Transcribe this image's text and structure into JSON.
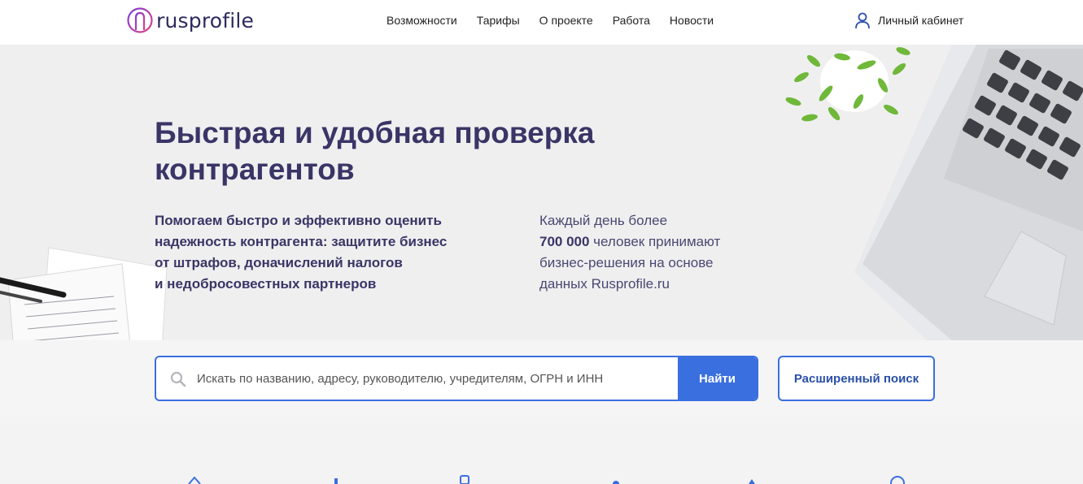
{
  "header": {
    "logo_text": "rusprofile",
    "nav": [
      {
        "label": "Возможности"
      },
      {
        "label": "Тарифы"
      },
      {
        "label": "О проекте"
      },
      {
        "label": "Работа"
      },
      {
        "label": "Новости"
      }
    ],
    "account_label": "Личный кабинет"
  },
  "hero": {
    "title_line1": "Быстрая и удобная проверка",
    "title_line2": "контрагентов",
    "desc_lines": [
      "Помогаем быстро и эффективно оценить",
      "надежность контрагента: защитите бизнес",
      "от штрафов, доначислений налогов",
      "и недобросовестных партнеров"
    ],
    "stats_line1": "Каждый день более",
    "stats_number": "700 000",
    "stats_line2_rest": " человек принимают",
    "stats_line3": "бизнес-решения на основе",
    "stats_line4": "данных Rusprofile.ru"
  },
  "search": {
    "placeholder": "Искать по названию, адресу, руководителю, учредителям, ОГРН и ИНН",
    "value": "",
    "submit_label": "Найти",
    "advanced_label": "Расширенный поиск"
  },
  "colors": {
    "accent": "#3a6fe0",
    "heading": "#3a3566",
    "hero_bg": "#efeff0"
  }
}
